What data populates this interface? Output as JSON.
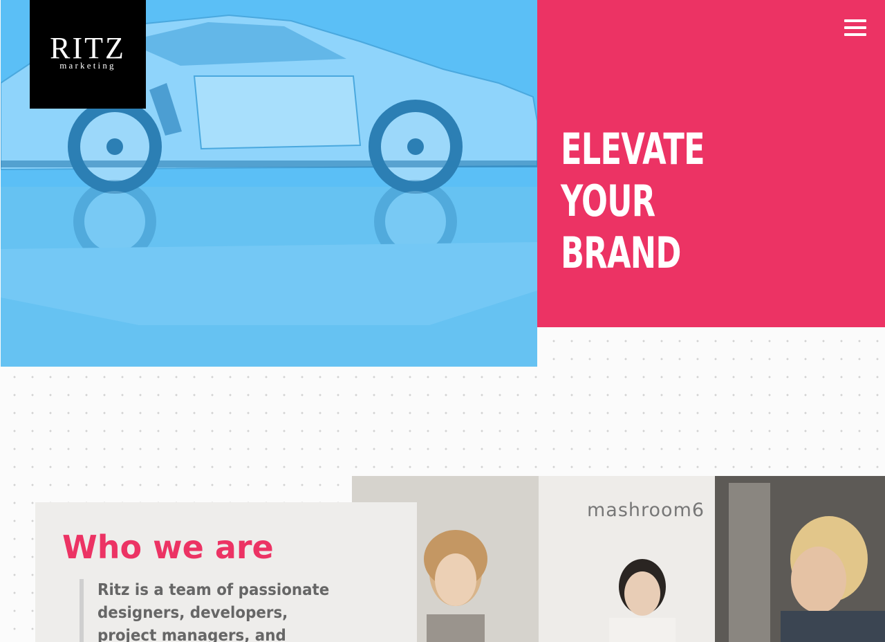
{
  "logo": {
    "title": "RITZ",
    "subtitle": "marketing"
  },
  "header": {
    "menu_icon": "hamburger-menu-icon"
  },
  "hero": {
    "heading_lines": [
      "ELEVATE",
      "YOUR",
      "BRAND"
    ]
  },
  "team_image": {
    "sign_text": "mashroom6"
  },
  "about": {
    "title": "Who we are",
    "text": "Ritz is a team of passionate designers, developers, project managers, and consultants that"
  },
  "colors": {
    "accent_pink": "#ec3364",
    "hero_blue": "#5bbff6",
    "logo_black": "#000000",
    "card_gray": "#eeedeb",
    "body_text": "#666666"
  }
}
